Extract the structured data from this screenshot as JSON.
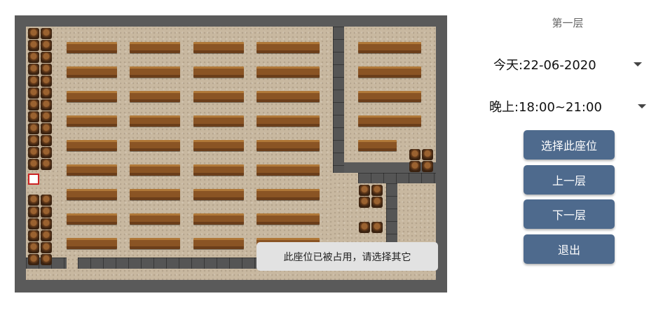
{
  "header": {
    "floor_label": "第一层"
  },
  "date_spinner": {
    "value": "今天:22-06-2020",
    "icon": "dropdown-arrow-icon"
  },
  "time_spinner": {
    "value": "晚上:18:00~21:00",
    "icon": "dropdown-arrow-icon"
  },
  "buttons": {
    "select_seat": "选择此座位",
    "prev_floor": "上一层",
    "next_floor": "下一层",
    "exit": "退出"
  },
  "toast": {
    "message": "此座位已被占用，请选择其它"
  },
  "map": {
    "tiles": {
      "floor": "beige-carpet",
      "wall": "gray-stone",
      "desk": "wooden-desk",
      "seat": "wooden-stool"
    },
    "colors": {
      "floor": "#c8b8a0",
      "wall": "#555555",
      "desk": "#8a5424",
      "selected": "#ffffff",
      "button": "#4e6a8d"
    }
  }
}
